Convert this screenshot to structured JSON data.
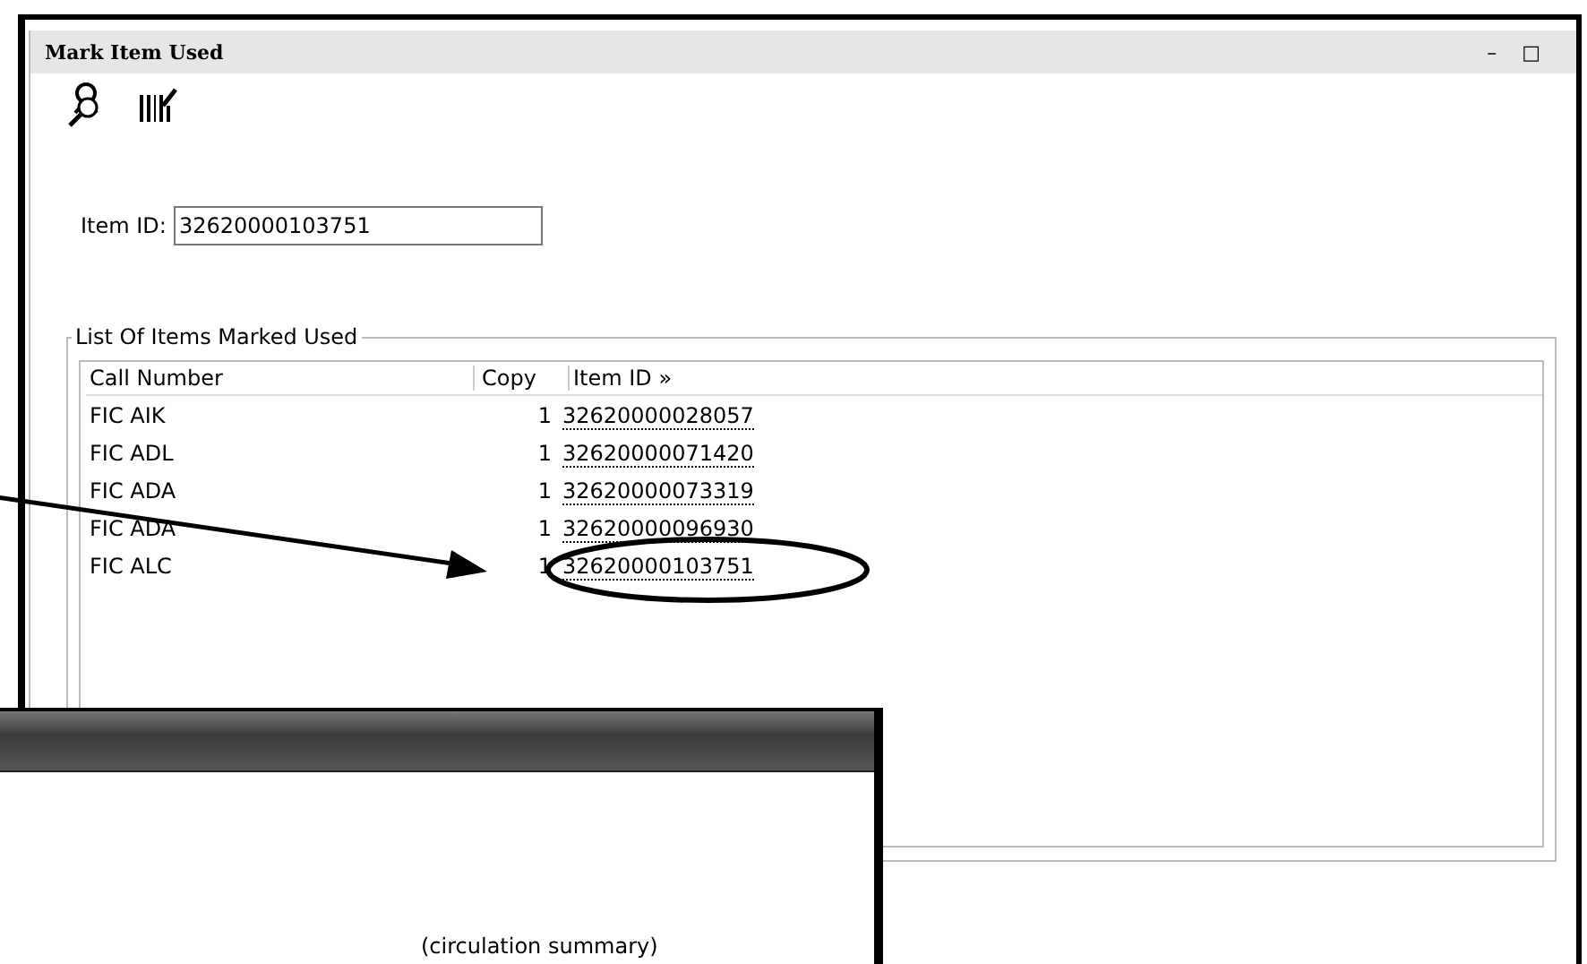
{
  "window": {
    "title": "Mark Item Used",
    "controls": [
      "–",
      "□"
    ]
  },
  "item_id": {
    "label": "Item ID:",
    "value": "32620000103751"
  },
  "list": {
    "legend": "List Of Items Marked Used",
    "columns": [
      "Call Number",
      "Copy",
      "Item ID »"
    ],
    "rows": [
      {
        "call_number": "FIC AIK",
        "copy": "1",
        "item_id": "32620000028057",
        "circled": false
      },
      {
        "call_number": "FIC ADL",
        "copy": "1",
        "item_id": "32620000071420",
        "circled": false
      },
      {
        "call_number": "FIC ADA",
        "copy": "1",
        "item_id": "32620000073319",
        "circled": false
      },
      {
        "call_number": "FIC ADA",
        "copy": "1",
        "item_id": "32620000096930",
        "circled": false
      },
      {
        "call_number": "FIC ALC",
        "copy": "1",
        "item_id": "32620000103751",
        "circled": true
      }
    ]
  },
  "second_window": {
    "caption": "(circulation summary)"
  }
}
